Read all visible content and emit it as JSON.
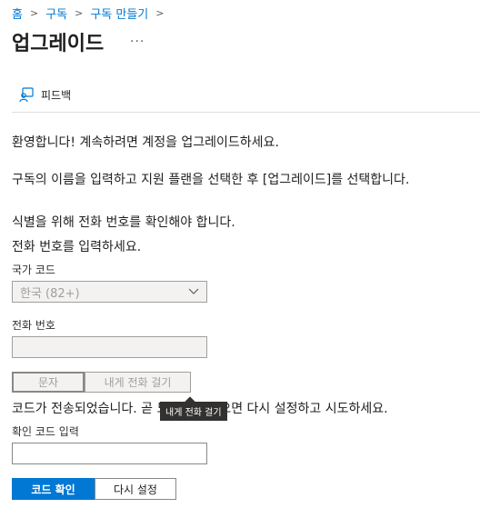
{
  "breadcrumb": {
    "items": [
      "홈",
      "구독",
      "구독 만들기"
    ]
  },
  "page": {
    "title": "업그레이드",
    "more_label": "···"
  },
  "toolbar": {
    "feedback_label": "피드백"
  },
  "content": {
    "welcome": "환영합니다! 계속하려면 계정을 업그레이드하세요.",
    "instruction": "구독의 이름을 입력하고 지원 플랜을 선택한 후 [업그레이드]를 선택합니다.",
    "verify_line1": "식별을 위해 전화 번호를 확인해야 합니다.",
    "verify_line2": "전화 번호를 입력하세요."
  },
  "form": {
    "country_label": "국가 코드",
    "country_value": "한국 (82+)",
    "phone_label": "전화 번호",
    "phone_value": "",
    "sms_button": "문자",
    "call_button": "내게 전화 걸기",
    "sent_message": "코드가 전송되었습니다. 곧 도착하지 않으면 다시 설정하고 시도하세요.",
    "code_label": "확인 코드 입력",
    "code_value": "",
    "verify_button": "코드 확인",
    "reset_button": "다시 설정"
  },
  "tooltip": {
    "text": "내게 전화 걸기"
  },
  "colors": {
    "accent": "#0078d4",
    "disabled_bg": "#f3f2f1",
    "disabled_text": "#a19f9d",
    "tooltip_bg": "#323130"
  }
}
